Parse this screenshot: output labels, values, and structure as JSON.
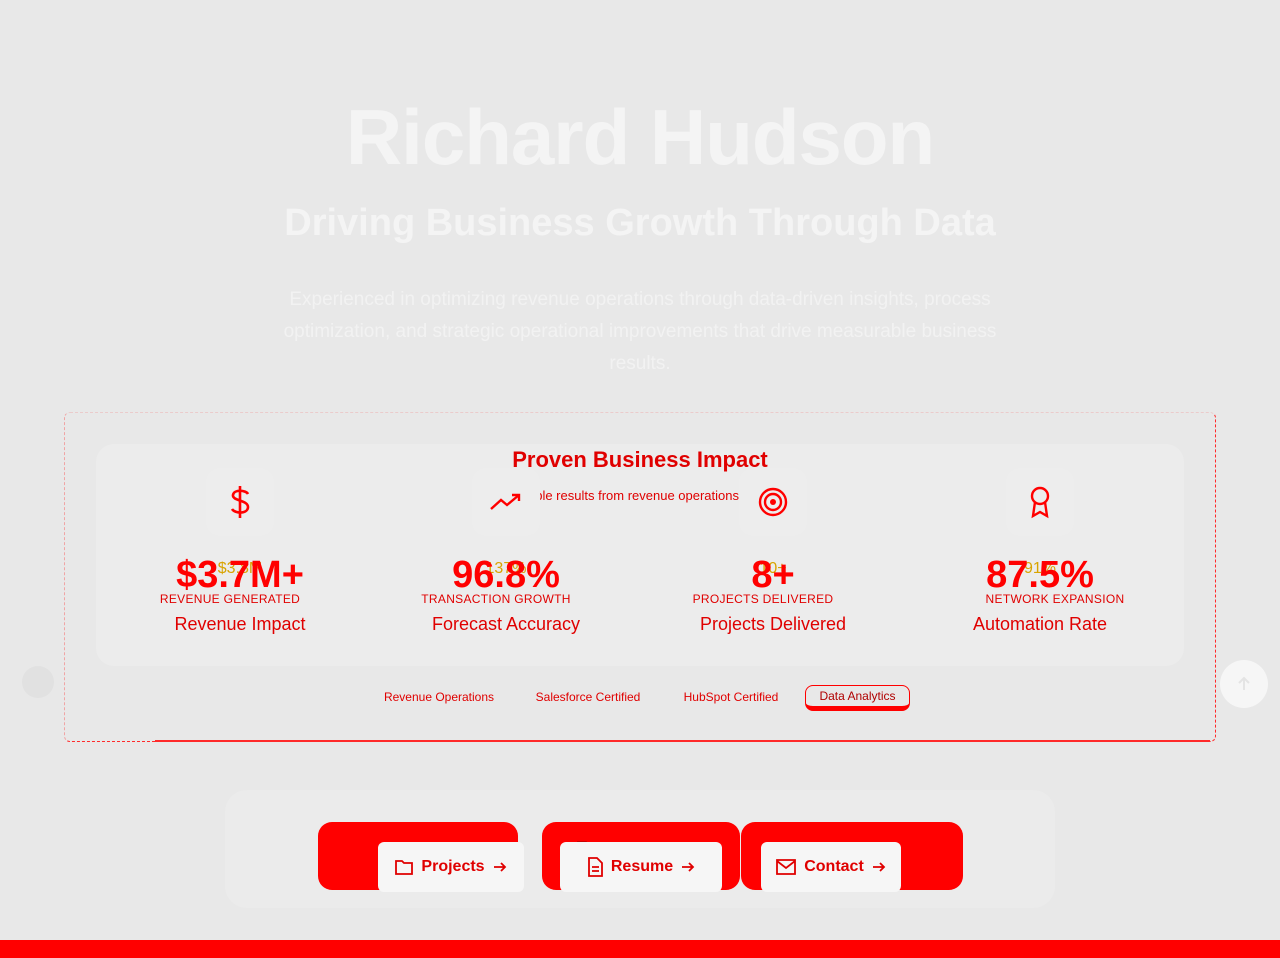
{
  "hero": {
    "name": "Richard Hudson",
    "tagline": "Driving Business Growth Through Data",
    "description": "Experienced in optimizing revenue operations through data-driven insights, process optimization, and strategic operational improvements that drive measurable business results."
  },
  "impact": {
    "title": "Proven Business Impact",
    "subtitle": "Measurable results from revenue operations expertise",
    "stats": [
      {
        "icon": "dollar-icon",
        "value": "$3.7M+",
        "ghost_value": "$3.8M",
        "caption": "REVENUE GENERATED",
        "label": "Revenue Impact"
      },
      {
        "icon": "trending-up-icon",
        "value": "96.8%",
        "ghost_value": "137%",
        "caption": "TRANSACTION GROWTH",
        "label": "Forecast Accuracy"
      },
      {
        "icon": "target-icon",
        "value": "8+",
        "ghost_value": "10+",
        "caption": "PROJECTS DELIVERED",
        "label": "Projects Delivered"
      },
      {
        "icon": "award-icon",
        "value": "87.5%",
        "ghost_value": "91%",
        "caption": "NETWORK EXPANSION",
        "label": "Automation Rate"
      }
    ],
    "tags": [
      "Revenue Operations",
      "Salesforce Certified",
      "HubSpot Certified",
      "Data Analytics"
    ],
    "active_tag": "Data Analytics"
  },
  "cta": {
    "buttons": [
      {
        "icon": "folder-icon",
        "label": "Projects"
      },
      {
        "icon": "document-icon",
        "label": "Resume"
      },
      {
        "icon": "mail-icon",
        "label": "Contact"
      }
    ]
  },
  "colors": {
    "accent": "#ff0000",
    "background": "#e8e8e8",
    "hero_text": "#f4f4f4"
  }
}
